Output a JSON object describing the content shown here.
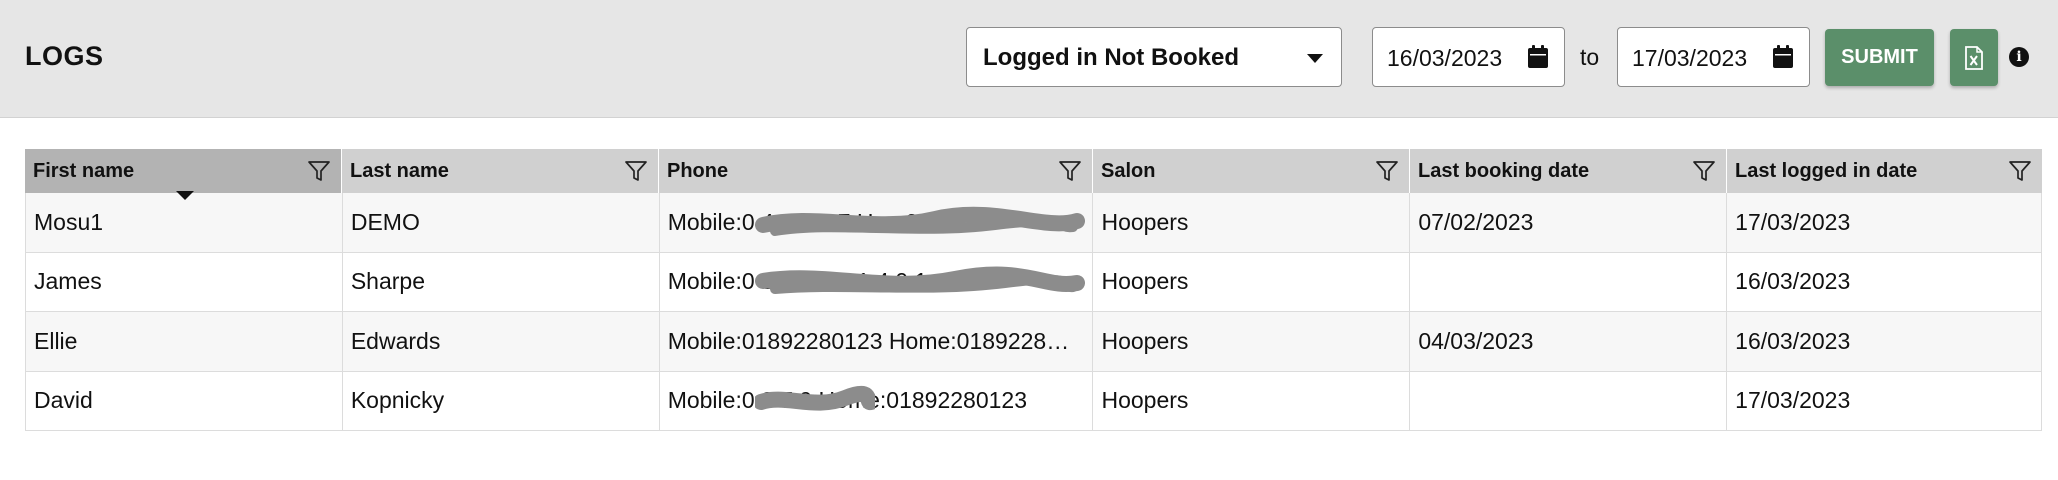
{
  "header": {
    "title": "LOGS",
    "report_type": "Logged in Not Booked",
    "date_from": "16/03/2023",
    "to_label": "to",
    "date_to": "17/03/2023",
    "submit_label": "SUBMIT",
    "info_glyph": "i"
  },
  "icons": {
    "calendar": "calendar-icon",
    "excel": "excel-export-icon",
    "info": "info-icon",
    "filter": "filter-icon",
    "dropdown": "chevron-down-icon"
  },
  "colors": {
    "accent": "#5b8f6a",
    "header_bg": "#e6e6e6",
    "table_header": "#d0d0d0",
    "sorted_column": "#b3b3b3"
  },
  "table": {
    "columns": [
      "First name",
      "Last name",
      "Phone",
      "Salon",
      "Last booking date",
      "Last logged in date"
    ],
    "rows": [
      {
        "first_name": "Mosu1",
        "last_name": "DEMO",
        "phone": "Mobile:0 4 9 6 5 7 H m 2 8…",
        "salon": "Hoopers",
        "last_booking": "07/02/2023",
        "last_logged_in": "17/03/2023"
      },
      {
        "first_name": "James",
        "last_name": "Sharpe",
        "phone": "Mobile:0 3 0 1 3 1 1 4 0 1 …8…",
        "salon": "Hoopers",
        "last_booking": "",
        "last_logged_in": "16/03/2023"
      },
      {
        "first_name": "Ellie",
        "last_name": "Edwards",
        "phone": "Mobile:01892280123 Home:0189228…",
        "salon": "Hoopers",
        "last_booking": "04/03/2023",
        "last_logged_in": "16/03/2023"
      },
      {
        "first_name": "David",
        "last_name": "Kopnicky",
        "phone": "Mobile:0 0 7 9      Home:01892280123",
        "salon": "Hoopers",
        "last_booking": "",
        "last_logged_in": "17/03/2023"
      }
    ]
  }
}
